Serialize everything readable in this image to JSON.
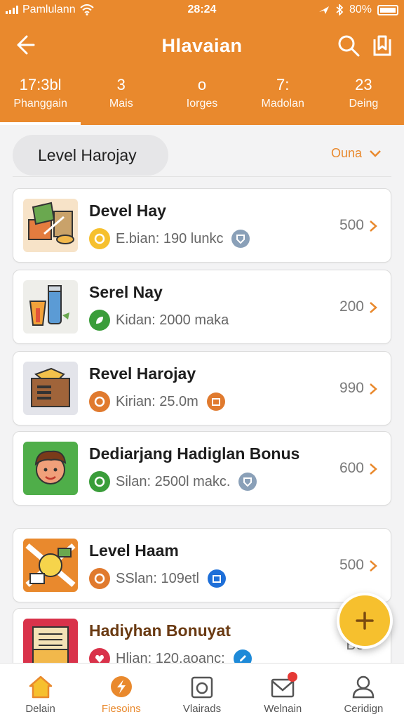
{
  "status_bar": {
    "carrier": "Pamlulann",
    "time": "28:24",
    "battery": "80%"
  },
  "header": {
    "title": "Hlavaian"
  },
  "stats": [
    {
      "value": "17:3bl",
      "label": "Phanggain"
    },
    {
      "value": "3",
      "label": "Mais"
    },
    {
      "value": "o",
      "label": "Iorges"
    },
    {
      "value": "7:",
      "label": "Madolan"
    },
    {
      "value": "23",
      "label": "Deing"
    }
  ],
  "filter": {
    "pill_label": "Level Harojay",
    "sort_label": "Ouna"
  },
  "items": [
    {
      "title": "Devel Hay",
      "sub": "E.bian: 190 lunkc",
      "value": "500"
    },
    {
      "title": "Serel Nay",
      "sub": "Kidan: 2000 maka",
      "value": "200"
    },
    {
      "title": "Revel Harojay",
      "sub": "Kirian: 25.0m",
      "value": "990"
    },
    {
      "title": "Dediarjang Hadiglan Bonus",
      "sub": "Silan: 2500l makc.",
      "value": "600"
    },
    {
      "title": "Level Haam",
      "sub": "SSlan: 109etl",
      "value": "500"
    },
    {
      "title": "Hadiyhan Bonuyat",
      "sub": "Hlian: 120.aoanc:",
      "value": "Bo"
    }
  ],
  "bottom_nav": [
    {
      "label": "Delain"
    },
    {
      "label": "Fiesoins"
    },
    {
      "label": "Vlairads"
    },
    {
      "label": "Welnain"
    },
    {
      "label": "Ceridign"
    }
  ],
  "colors": {
    "accent": "#e9892d",
    "fab": "#f6c02e"
  }
}
